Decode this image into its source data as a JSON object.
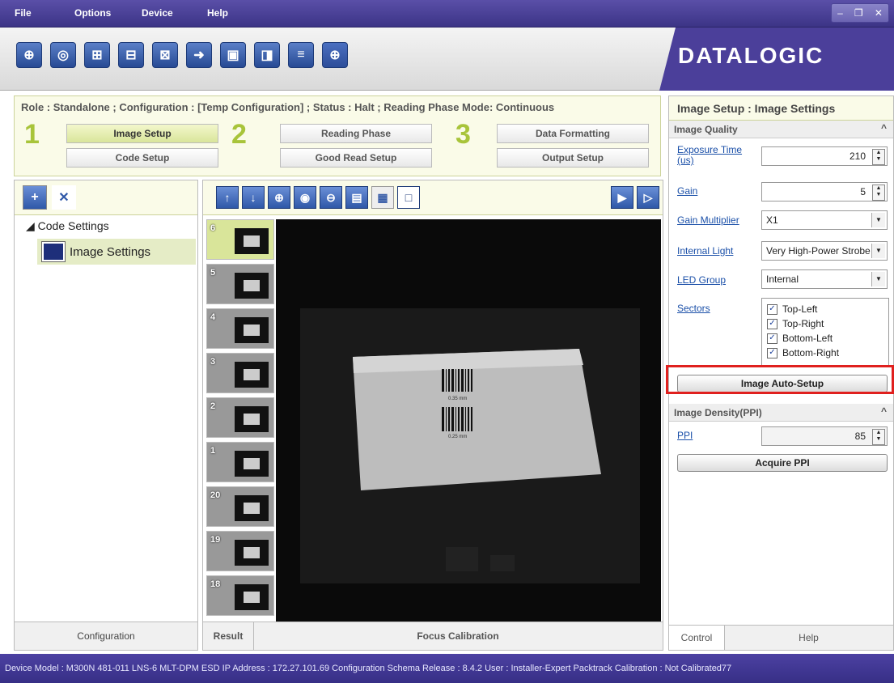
{
  "menu": {
    "items": [
      "File",
      "Options",
      "Device",
      "Help"
    ],
    "window_controls": [
      "–",
      "❐",
      "✕"
    ]
  },
  "brand": {
    "logo": "DATALOGIC",
    "color": "#4b3f9a",
    "accent": "#a8c43a"
  },
  "toolbar": {
    "icons": [
      "connect-icon",
      "discover-icon",
      "open-config-icon",
      "save-config-icon",
      "save-as-icon",
      "export-icon",
      "send-icon",
      "receive-icon",
      "diagnostics-icon",
      "target-icon"
    ]
  },
  "role_bar": {
    "text": "Role : Standalone ; Configuration : [Temp Configuration] ; Status : Halt ; Reading Phase Mode: Continuous",
    "step_numbers": [
      "1",
      "2",
      "3"
    ],
    "buttons": {
      "image_setup": "Image Setup",
      "code_setup": "Code Setup",
      "reading_phase": "Reading Phase",
      "good_read_setup": "Good Read Setup",
      "data_formatting": "Data Formatting",
      "output_setup": "Output Setup"
    }
  },
  "left_panel": {
    "tree_root": "◢ Code Settings",
    "tree_child": "Image Settings",
    "footer": "Configuration"
  },
  "center_panel": {
    "thumbnails": [
      "6",
      "5",
      "4",
      "3",
      "2",
      "1",
      "20",
      "19",
      "18"
    ],
    "image_labels": [
      "0.35 mm",
      "0.25 mm"
    ],
    "footer_tabs": {
      "result": "Result",
      "focus": "Focus Calibration"
    }
  },
  "right_panel": {
    "title": "Image Setup : Image Settings",
    "image_quality": {
      "header": "Image Quality",
      "exposure_label": "Exposure Time (us)",
      "exposure_value": "210",
      "gain_label": "Gain",
      "gain_value": "5",
      "gain_mult_label": "Gain Multiplier",
      "gain_mult_value": "X1",
      "internal_light_label": "Internal Light",
      "internal_light_value": "Very High-Power Strobe",
      "led_group_label": "LED Group",
      "led_group_value": "Internal",
      "sectors_label": "Sectors",
      "sectors": [
        "Top-Left",
        "Top-Right",
        "Bottom-Left",
        "Bottom-Right"
      ],
      "auto_setup": "Image Auto-Setup"
    },
    "image_density": {
      "header": "Image Density(PPI)",
      "ppi_label": "PPI",
      "ppi_value": "85",
      "acquire": "Acquire PPI"
    },
    "footer_tabs": {
      "control": "Control",
      "help": "Help"
    }
  },
  "status_bar": "Device Model : M300N  481-011  LNS-6 MLT-DPM ESD  IP Address : 172.27.101.69  Configuration Schema Release : 8.4.2  User : Installer-Expert  Packtrack Calibration : Not Calibrated77"
}
